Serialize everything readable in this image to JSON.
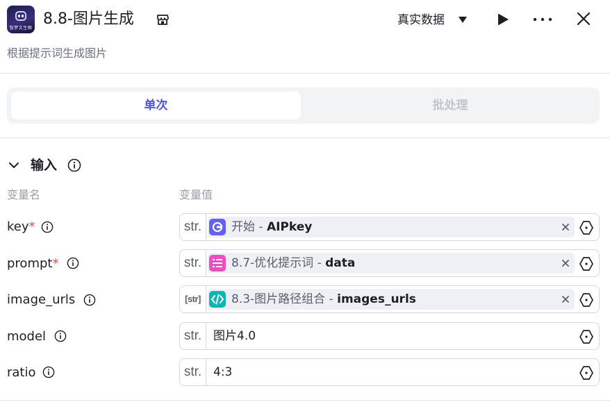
{
  "header": {
    "logo_text": "智梦文生图",
    "title": "8.8-图片生成",
    "icons": {
      "store": "store-icon",
      "play": "play-icon",
      "more": "more-icon",
      "close": "close-icon"
    },
    "data_mode": "真实数据"
  },
  "subtitle": "根据提示词生成图片",
  "tabs": [
    {
      "label": "单次",
      "active": true
    },
    {
      "label": "批处理",
      "active": false
    }
  ],
  "input_section": {
    "title": "输入",
    "col_name": "变量名",
    "col_value": "变量值",
    "rows": [
      {
        "name": "key",
        "required_mark": "*",
        "type": "str.",
        "node": "开始",
        "sep": " - ",
        "var": "AIPkey",
        "icon_color": "#6461f2",
        "icon": "start-node-icon"
      },
      {
        "name": "prompt",
        "required_mark": "*",
        "type": "str.",
        "node": "8.7-优化提示词",
        "sep": " - ",
        "var": "data",
        "icon_color": "#ea4ec0",
        "icon": "list-node-icon"
      },
      {
        "name": "image_urls",
        "type": "[str]",
        "node": "8.3-图片路径组合",
        "sep": " - ",
        "var": "images_urls",
        "icon_color": "#10b5b0",
        "icon": "code-node-icon"
      },
      {
        "name": "model",
        "type": "str.",
        "value": "图片4.0"
      },
      {
        "name": "ratio",
        "type": "str.",
        "value": "4:3"
      }
    ]
  },
  "colors": {
    "accent": "#4d53e8",
    "required": "#e54848",
    "muted": "#9a9ea9"
  }
}
